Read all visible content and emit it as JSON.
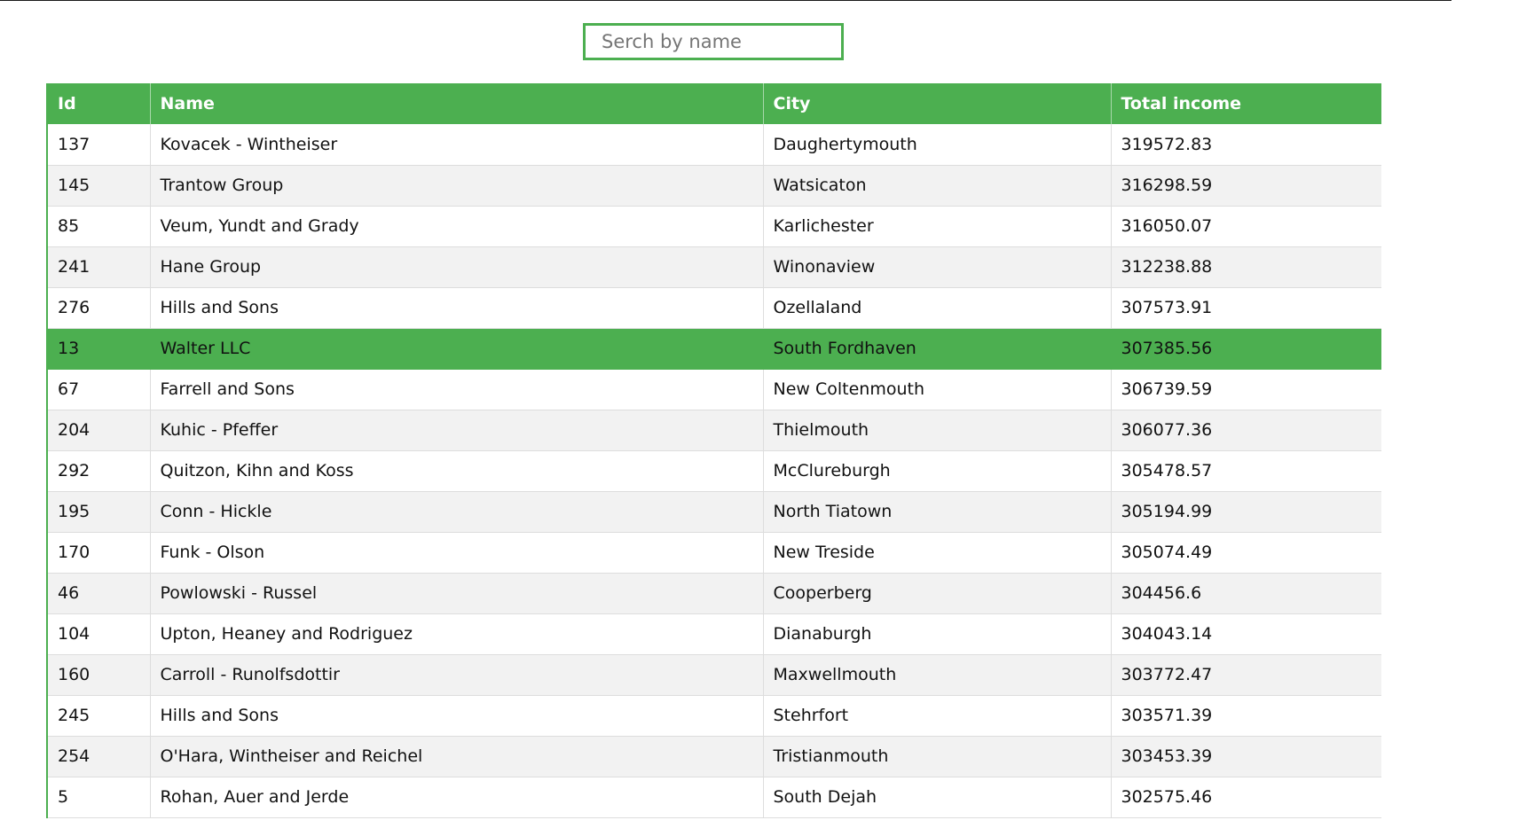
{
  "search": {
    "placeholder": "Serch by name",
    "value": ""
  },
  "colors": {
    "accent": "#4caf50",
    "row_alt": "#f2f2f2",
    "header_text": "#ffffff"
  },
  "table": {
    "columns": [
      "Id",
      "Name",
      "City",
      "Total income"
    ],
    "selected_row_index": 5,
    "rows": [
      {
        "id": "137",
        "name": "Kovacek - Wintheiser",
        "city": "Daughertymouth",
        "income": "319572.83"
      },
      {
        "id": "145",
        "name": "Trantow Group",
        "city": "Watsicaton",
        "income": "316298.59"
      },
      {
        "id": "85",
        "name": "Veum, Yundt and Grady",
        "city": "Karlichester",
        "income": "316050.07"
      },
      {
        "id": "241",
        "name": "Hane Group",
        "city": "Winonaview",
        "income": "312238.88"
      },
      {
        "id": "276",
        "name": "Hills and Sons",
        "city": "Ozellaland",
        "income": "307573.91"
      },
      {
        "id": "13",
        "name": "Walter LLC",
        "city": "South Fordhaven",
        "income": "307385.56"
      },
      {
        "id": "67",
        "name": "Farrell and Sons",
        "city": "New Coltenmouth",
        "income": "306739.59"
      },
      {
        "id": "204",
        "name": "Kuhic - Pfeffer",
        "city": "Thielmouth",
        "income": "306077.36"
      },
      {
        "id": "292",
        "name": "Quitzon, Kihn and Koss",
        "city": "McClureburgh",
        "income": "305478.57"
      },
      {
        "id": "195",
        "name": "Conn - Hickle",
        "city": "North Tiatown",
        "income": "305194.99"
      },
      {
        "id": "170",
        "name": "Funk - Olson",
        "city": "New Treside",
        "income": "305074.49"
      },
      {
        "id": "46",
        "name": "Powlowski - Russel",
        "city": "Cooperberg",
        "income": "304456.6"
      },
      {
        "id": "104",
        "name": "Upton, Heaney and Rodriguez",
        "city": "Dianaburgh",
        "income": "304043.14"
      },
      {
        "id": "160",
        "name": "Carroll - Runolfsdottir",
        "city": "Maxwellmouth",
        "income": "303772.47"
      },
      {
        "id": "245",
        "name": "Hills and Sons",
        "city": "Stehrfort",
        "income": "303571.39"
      },
      {
        "id": "254",
        "name": "O'Hara, Wintheiser and Reichel",
        "city": "Tristianmouth",
        "income": "303453.39"
      },
      {
        "id": "5",
        "name": "Rohan, Auer and Jerde",
        "city": "South Dejah",
        "income": "302575.46"
      }
    ]
  }
}
